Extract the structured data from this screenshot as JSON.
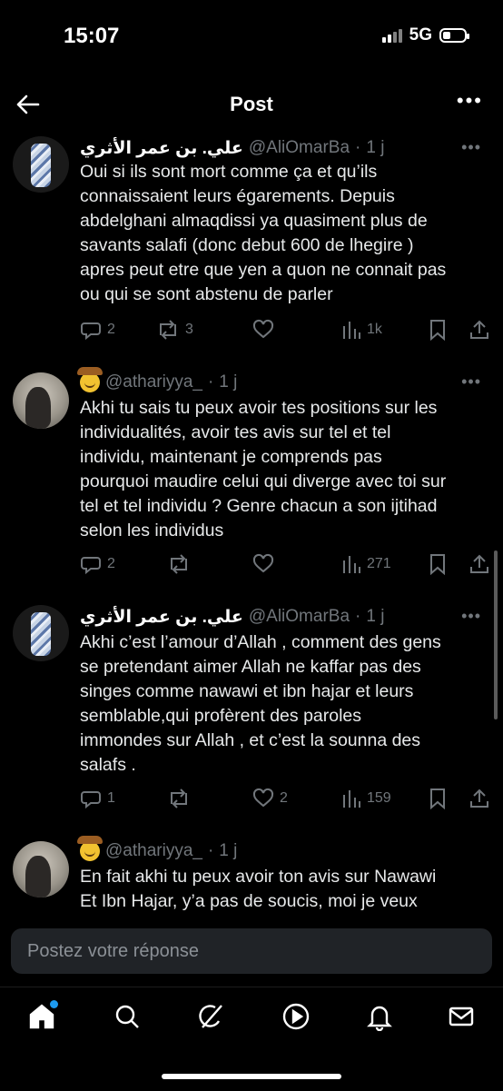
{
  "status_bar": {
    "time": "15:07",
    "network": "5G",
    "battery_level": 0.35
  },
  "header": {
    "title": "Post",
    "back_icon": "arrow-left-icon",
    "more_icon": "more-dots-icon"
  },
  "tweets": [
    {
      "avatar": "bottle-image",
      "name": "علي. بن عمر الأثري",
      "handle": "@AliOmarBa",
      "time": "1 j",
      "text": "Oui si ils sont mort comme ça et qu’ils\nconnaissaient leurs égarements. Depuis\nabdelghani almaqdissi ya quasiment plus de\nsavants salafi (donc debut 600 de lhegire )\napres peut etre que yen a quon ne connait pas\nou qui se sont abstenu de parler",
      "replies": "2",
      "reposts": "3",
      "likes": "",
      "views": "1k"
    },
    {
      "avatar": "person-photo",
      "emoji": "cowboy-emoji",
      "name": "",
      "handle": "@athariyya_",
      "time": "1 j",
      "text": "Akhi tu sais tu peux avoir tes positions sur les\nindividualités, avoir tes avis sur tel et tel\nindividu, maintenant je comprends pas\npourquoi maudire celui qui diverge avec toi sur\ntel et tel individu ? Genre chacun a son ijtihad\nselon les individus",
      "replies": "2",
      "reposts": "",
      "likes": "",
      "views": "271"
    },
    {
      "avatar": "bottle-image",
      "name": "علي. بن عمر الأثري",
      "handle": "@AliOmarBa",
      "time": "1 j",
      "text": "Akhi c’est l’amour d’Allah , comment des gens\nse pretendant aimer Allah ne kaffar pas des\nsinges comme nawawi et ibn hajar et leurs\nsemblable,qui profèrent des paroles\nimmondes sur Allah , et c’est la sounna des\nsalafs .",
      "replies": "1",
      "reposts": "",
      "likes": "2",
      "views": "159"
    },
    {
      "avatar": "person-photo",
      "emoji": "cowboy-emoji",
      "name": "",
      "handle": "@athariyya_",
      "time": "1 j",
      "text": "En fait akhi tu peux avoir ton avis sur Nawawi\nEt Ibn Hajar, y’a pas de soucis, moi je veux",
      "replies": "",
      "reposts": "",
      "likes": "",
      "views": ""
    }
  ],
  "reply": {
    "placeholder": "Postez votre réponse"
  },
  "tabs": [
    "home-icon",
    "search-icon",
    "grok-icon",
    "video-icon",
    "notifications-icon",
    "messages-icon"
  ],
  "colors": {
    "background": "#000000",
    "secondary_text": "#71767b",
    "accent": "#1d9bf0",
    "input_bg": "#202327"
  }
}
